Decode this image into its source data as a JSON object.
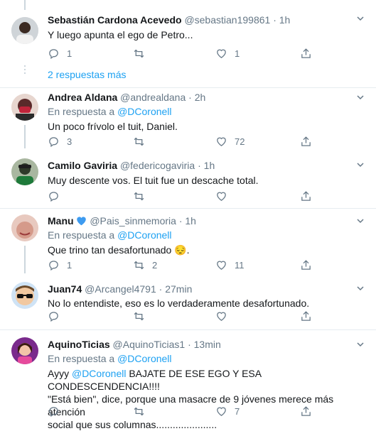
{
  "tweets": [
    {
      "name": "Sebastián Cardona Acevedo",
      "handle": "@sebastian199861",
      "time": "1h",
      "reply_prefix": "",
      "reply_to": "",
      "text": "Y luego apunta el ego de Petro...",
      "replies": "1",
      "retweets": "",
      "likes": "1"
    },
    {
      "name": "Andrea Aldana",
      "handle": "@andrealdana",
      "time": "2h",
      "reply_prefix": "En respuesta a",
      "reply_to": "@DCoronell",
      "text": "Un poco frívolo el tuit, Daniel.",
      "replies": "3",
      "retweets": "",
      "likes": "72"
    },
    {
      "name": "Camilo Gaviria",
      "handle": "@federicogaviria",
      "time": "1h",
      "reply_prefix": "",
      "reply_to": "",
      "text": "Muy descente vos. El tuit fue un descache total.",
      "replies": "",
      "retweets": "",
      "likes": ""
    },
    {
      "name": "Manu",
      "handle": "@Pais_sinmemoria",
      "time": "1h",
      "reply_prefix": "En respuesta a",
      "reply_to": "@DCoronell",
      "text": "Que trino tan desafortunado 😔.",
      "replies": "1",
      "retweets": "2",
      "likes": "11"
    },
    {
      "name": "Juan74",
      "handle": "@Arcangel4791",
      "time": "27min",
      "reply_prefix": "",
      "reply_to": "",
      "text": "No lo entendiste, eso es lo verdaderamente desafortunado.",
      "replies": "",
      "retweets": "",
      "likes": ""
    },
    {
      "name": "AquinoTicias",
      "handle": "@AquinoTicias1",
      "time": "13min",
      "reply_prefix": "En respuesta a",
      "reply_to": "@DCoronell",
      "text_mention": "@DCoronell",
      "text_pre": "Ayyy",
      "text_line1": "BAJATE DE ESE EGO Y ESA CONDESCENDENCIA!!!!",
      "text_line2": "\"Está bien\", dice, porque una masacre de 9 jóvenes merece más atención",
      "text_line3": "social que sus columnas......................",
      "replies": "",
      "retweets": "",
      "likes": "7"
    }
  ],
  "thread": {
    "more_replies": "2 respuestas más"
  },
  "icons": {
    "reply": "reply-icon",
    "retweet": "retweet-icon",
    "like": "heart-icon",
    "share": "share-icon",
    "more": "chevron-down-icon",
    "verified_heart": "blue-heart-icon"
  },
  "colors": {
    "link": "#1da1f2",
    "muted": "#657786",
    "text": "#14171a",
    "border": "#e6ecf0"
  }
}
